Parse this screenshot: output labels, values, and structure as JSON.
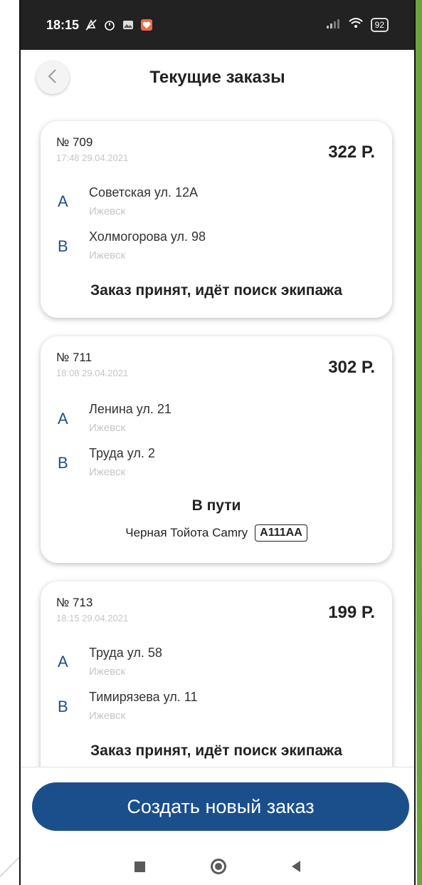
{
  "status_bar": {
    "time": "18:15",
    "battery": "92",
    "icons": [
      "notifications-off-icon",
      "alarm-icon",
      "gallery-icon",
      "heart-app-icon",
      "signal-icon",
      "wifi-icon",
      "battery-icon"
    ]
  },
  "header": {
    "title": "Текущие заказы",
    "back_icon": "chevron-left-icon"
  },
  "orders": [
    {
      "number": "№ 709",
      "datetime": "17:48 29.04.2021",
      "price": "322 Р.",
      "from": {
        "letter": "A",
        "street": "Советская ул. 12А",
        "city": "Ижевск"
      },
      "to": {
        "letter": "B",
        "street": "Холмогорова ул. 98",
        "city": "Ижевск"
      },
      "status": "Заказ принят, идёт поиск экипажа"
    },
    {
      "number": "№ 711",
      "datetime": "18:08 29.04.2021",
      "price": "302 Р.",
      "from": {
        "letter": "A",
        "street": "Ленина ул. 21",
        "city": "Ижевск"
      },
      "to": {
        "letter": "B",
        "street": "Труда ул. 2",
        "city": "Ижевск"
      },
      "status": "В пути",
      "car": "Черная Тойота Camry",
      "plate": "А111АА"
    },
    {
      "number": "№ 713",
      "datetime": "18:15 29.04.2021",
      "price": "199 Р.",
      "from": {
        "letter": "A",
        "street": "Труда ул. 58",
        "city": "Ижевск"
      },
      "to": {
        "letter": "B",
        "street": "Тимирязева ул. 11",
        "city": "Ижевск"
      },
      "status": "Заказ принят, идёт поиск экипажа"
    }
  ],
  "actions": {
    "create_label": "Создать новый заказ"
  },
  "colors": {
    "accent": "#1b4f8c",
    "status_bar": "#222222",
    "slide_green": "#8bc34a"
  }
}
